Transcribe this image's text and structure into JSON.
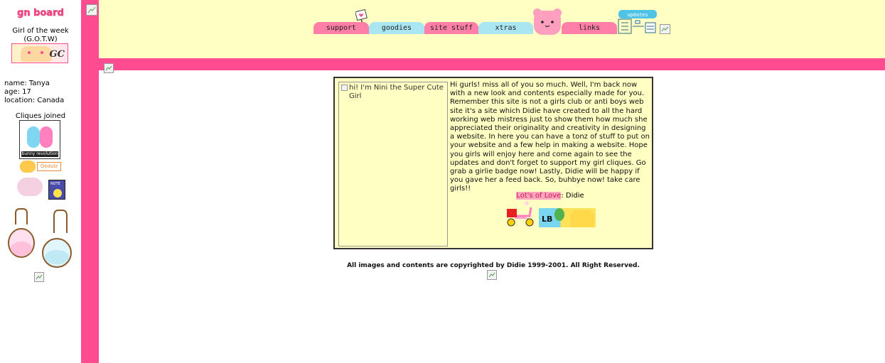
{
  "sidebar": {
    "logo_text": "gn board",
    "gotw_title": "Girl of the week (G.O.T.W)",
    "gotw_badge_text": "GC",
    "profile": {
      "name_line": "name: Tanya",
      "age_line": "age: 17",
      "location_line": "location: Canada"
    },
    "cliques_label": "Cliques joined",
    "clique_bunny_caption": "bunny revolution",
    "clique_oodulz_label": "Oodulz",
    "clique_note_label": "NOTE"
  },
  "nav": {
    "tabs": [
      {
        "label": "support",
        "color": "#ff7fa8"
      },
      {
        "label": "goodies",
        "color": "#a9e6f2"
      },
      {
        "label": "site stuff",
        "color": "#ff7fa8"
      },
      {
        "label": "xtras",
        "color": "#a9e6f2"
      },
      {
        "label": "links",
        "color": "#ff7fa8"
      }
    ],
    "updates_label": "updates"
  },
  "content": {
    "image_alt": "hi! I'm Nini the Super Cute Girl",
    "welcome_text": "Hi gurls! miss all of you so much. Well, I'm back now with a new look and contents especially made for you. Remember this site is not a girls club or anti boys web site it's a site which Didie have created to all the hard working web mistress just to show them how much she appreciated their originality and creativity in designing a website. In here you can have a tonz of stuff to put on your website and a few help in making a website. Hope you girls will enjoy here and come again to see the updates and don't forget to support my girl cliques. Go grab a girlie badge now! Lastly, Didie will be happy if you gave her a feed back. So, buhbye now! take care girls!!",
    "signature_love": "Lot's of Love",
    "signature_rest": ": Didie",
    "lb_banner_text": "LB"
  },
  "footer": {
    "copyright": "All images and contents are copyrighted by Didie 1999-2001. All Right Reserved."
  },
  "colors": {
    "pink": "#ff4b8f",
    "cream": "#ffffc3",
    "tab_pink": "#ff7fa8",
    "tab_blue": "#a9e6f2"
  }
}
